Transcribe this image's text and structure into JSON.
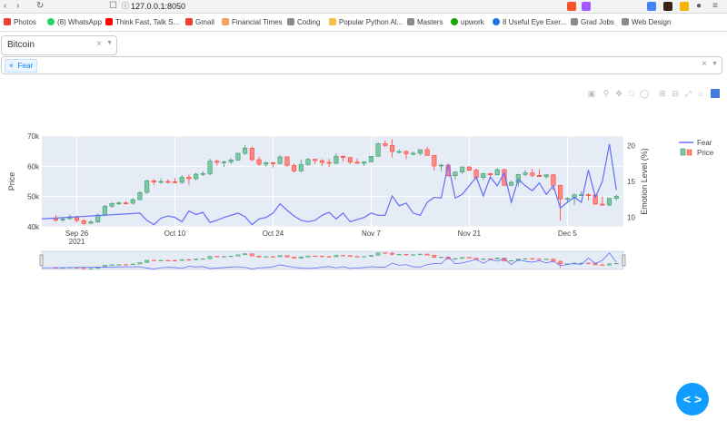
{
  "browser": {
    "url": "127.0.0.1:8050"
  },
  "bookmarks": [
    {
      "label": "Photos",
      "color": "#ea4335"
    },
    {
      "label": "(8) WhatsApp",
      "color": "#25d366"
    },
    {
      "label": "Think Fast, Talk S...",
      "color": "#ff0000"
    },
    {
      "label": "Gmail",
      "color": "#ea4335"
    },
    {
      "label": "Financial Times",
      "color": "#f4a261"
    },
    {
      "label": "Coding",
      "color": "#8a8a8a"
    },
    {
      "label": "Popular Python Al...",
      "color": "#f6c343"
    },
    {
      "label": "Masters",
      "color": "#8a8a8a"
    },
    {
      "label": "upwork",
      "color": "#14a800"
    },
    {
      "label": "8 Useful Eye Exer...",
      "color": "#1a73e8"
    },
    {
      "label": "Grad Jobs",
      "color": "#8a8a8a"
    },
    {
      "label": "Web Design",
      "color": "#8a8a8a"
    }
  ],
  "controls": {
    "coin_dropdown_value": "Bitcoin",
    "indicator_tags": [
      "Fear"
    ]
  },
  "chart_data": {
    "type": "candlestick+line",
    "y_left_label": "Price",
    "y_right_label": "Emotion Level (%)",
    "y_left_ticks": [
      "40k",
      "50k",
      "60k",
      "70k"
    ],
    "y_left_range": [
      40000,
      70000
    ],
    "y_right_ticks": [
      "10",
      "15",
      "20"
    ],
    "y_right_range": [
      8.7,
      21.3
    ],
    "x_ticks": [
      {
        "date": "2021-09-26",
        "label": "Sep 26",
        "sub": "2021"
      },
      {
        "date": "2021-10-10",
        "label": "Oct 10",
        "sub": ""
      },
      {
        "date": "2021-10-24",
        "label": "Oct 24",
        "sub": ""
      },
      {
        "date": "2021-11-07",
        "label": "Nov 7",
        "sub": ""
      },
      {
        "date": "2021-11-21",
        "label": "Nov 21",
        "sub": ""
      },
      {
        "date": "2021-12-05",
        "label": "Dec 5",
        "sub": ""
      }
    ],
    "x_range": [
      "2021-09-21",
      "2021-12-13"
    ],
    "colors": {
      "increasing": "#3d9970",
      "increasing_fill": "#7cc8a2",
      "decreasing": "#ff4136",
      "decreasing_fill": "#ff8a84",
      "fear": "#636efa",
      "plot_bg": "#e5ecf6"
    },
    "legend": [
      {
        "name": "Fear",
        "kind": "line"
      },
      {
        "name": "Price",
        "kind": "candle"
      }
    ],
    "candles": [
      {
        "date": "2021-09-23",
        "open": 42900,
        "close": 42200,
        "high": 43900,
        "low": 41600
      },
      {
        "date": "2021-09-24",
        "open": 42200,
        "close": 42500,
        "high": 43100,
        "low": 41700
      },
      {
        "date": "2021-09-25",
        "open": 42700,
        "close": 43300,
        "high": 44000,
        "low": 42300
      },
      {
        "date": "2021-09-26",
        "open": 43300,
        "close": 42100,
        "high": 43700,
        "low": 41400
      },
      {
        "date": "2021-09-27",
        "open": 42000,
        "close": 41100,
        "high": 42600,
        "low": 40700
      },
      {
        "date": "2021-09-28",
        "open": 41200,
        "close": 41600,
        "high": 42300,
        "low": 40900
      },
      {
        "date": "2021-09-29",
        "open": 41600,
        "close": 43900,
        "high": 44300,
        "low": 41300
      },
      {
        "date": "2021-09-30",
        "open": 43900,
        "close": 46800,
        "high": 47200,
        "low": 43500
      },
      {
        "date": "2021-10-01",
        "open": 46800,
        "close": 47700,
        "high": 48100,
        "low": 46300
      },
      {
        "date": "2021-10-02",
        "open": 47700,
        "close": 47900,
        "high": 48400,
        "low": 47200
      },
      {
        "date": "2021-10-03",
        "open": 47900,
        "close": 47800,
        "high": 48500,
        "low": 47400
      },
      {
        "date": "2021-10-04",
        "open": 47800,
        "close": 49000,
        "high": 49500,
        "low": 47300
      },
      {
        "date": "2021-10-05",
        "open": 49000,
        "close": 51300,
        "high": 51700,
        "low": 48700
      },
      {
        "date": "2021-10-06",
        "open": 51400,
        "close": 55200,
        "high": 55600,
        "low": 50900
      },
      {
        "date": "2021-10-07",
        "open": 55200,
        "close": 54800,
        "high": 55800,
        "low": 53800
      },
      {
        "date": "2021-10-08",
        "open": 54800,
        "close": 55000,
        "high": 56000,
        "low": 54200
      },
      {
        "date": "2021-10-09",
        "open": 55000,
        "close": 54900,
        "high": 55600,
        "low": 54300
      },
      {
        "date": "2021-10-10",
        "open": 54900,
        "close": 54700,
        "high": 56100,
        "low": 54400
      },
      {
        "date": "2021-10-11",
        "open": 54700,
        "close": 56400,
        "high": 57100,
        "low": 54200
      },
      {
        "date": "2021-10-12",
        "open": 56400,
        "close": 55900,
        "high": 57300,
        "low": 54000
      },
      {
        "date": "2021-10-13",
        "open": 55900,
        "close": 57400,
        "high": 57800,
        "low": 55300
      },
      {
        "date": "2021-10-14",
        "open": 57400,
        "close": 57600,
        "high": 58300,
        "low": 56800
      },
      {
        "date": "2021-10-15",
        "open": 57600,
        "close": 61700,
        "high": 62500,
        "low": 57000
      },
      {
        "date": "2021-10-16",
        "open": 61700,
        "close": 61300,
        "high": 62300,
        "low": 60200
      },
      {
        "date": "2021-10-17",
        "open": 61300,
        "close": 61500,
        "high": 61900,
        "low": 59800
      },
      {
        "date": "2021-10-18",
        "open": 61500,
        "close": 62100,
        "high": 62700,
        "low": 60800
      },
      {
        "date": "2021-10-19",
        "open": 62100,
        "close": 64300,
        "high": 64500,
        "low": 61700
      },
      {
        "date": "2021-10-20",
        "open": 64300,
        "close": 66000,
        "high": 67000,
        "low": 63700
      },
      {
        "date": "2021-10-21",
        "open": 66000,
        "close": 62200,
        "high": 66600,
        "low": 61600
      },
      {
        "date": "2021-10-22",
        "open": 62200,
        "close": 60700,
        "high": 63200,
        "low": 60100
      },
      {
        "date": "2021-10-23",
        "open": 60700,
        "close": 61200,
        "high": 61700,
        "low": 59900
      },
      {
        "date": "2021-10-24",
        "open": 61200,
        "close": 60900,
        "high": 61500,
        "low": 59600
      },
      {
        "date": "2021-10-25",
        "open": 60900,
        "close": 63100,
        "high": 63700,
        "low": 60600
      },
      {
        "date": "2021-10-26",
        "open": 63100,
        "close": 60300,
        "high": 63300,
        "low": 59900
      },
      {
        "date": "2021-10-27",
        "open": 60300,
        "close": 58500,
        "high": 61000,
        "low": 58000
      },
      {
        "date": "2021-10-28",
        "open": 58500,
        "close": 60600,
        "high": 62200,
        "low": 58100
      },
      {
        "date": "2021-10-29",
        "open": 60600,
        "close": 62300,
        "high": 62800,
        "low": 60200
      },
      {
        "date": "2021-10-30",
        "open": 62300,
        "close": 61900,
        "high": 62500,
        "low": 60700
      },
      {
        "date": "2021-10-31",
        "open": 61900,
        "close": 61300,
        "high": 62400,
        "low": 60100
      },
      {
        "date": "2021-11-01",
        "open": 61300,
        "close": 61000,
        "high": 62400,
        "low": 59700
      },
      {
        "date": "2021-11-02",
        "open": 61000,
        "close": 63300,
        "high": 64300,
        "low": 60700
      },
      {
        "date": "2021-11-03",
        "open": 63300,
        "close": 62900,
        "high": 63600,
        "low": 61600
      },
      {
        "date": "2021-11-04",
        "open": 62900,
        "close": 61400,
        "high": 63100,
        "low": 60700
      },
      {
        "date": "2021-11-05",
        "open": 61400,
        "close": 61000,
        "high": 62600,
        "low": 60800
      },
      {
        "date": "2021-11-06",
        "open": 61000,
        "close": 61500,
        "high": 61600,
        "low": 60100
      },
      {
        "date": "2021-11-07",
        "open": 61500,
        "close": 63300,
        "high": 63300,
        "low": 61300
      },
      {
        "date": "2021-11-08",
        "open": 63300,
        "close": 67500,
        "high": 67800,
        "low": 63300
      },
      {
        "date": "2021-11-09",
        "open": 67500,
        "close": 66900,
        "high": 68500,
        "low": 66300
      },
      {
        "date": "2021-11-10",
        "open": 66900,
        "close": 64900,
        "high": 69000,
        "low": 62900
      },
      {
        "date": "2021-11-11",
        "open": 64900,
        "close": 64900,
        "high": 65600,
        "low": 64200
      },
      {
        "date": "2021-11-12",
        "open": 64900,
        "close": 64200,
        "high": 65300,
        "low": 62300
      },
      {
        "date": "2021-11-13",
        "open": 64200,
        "close": 64300,
        "high": 64900,
        "low": 63600
      },
      {
        "date": "2021-11-14",
        "open": 64300,
        "close": 65500,
        "high": 65500,
        "low": 63600
      },
      {
        "date": "2021-11-15",
        "open": 65500,
        "close": 63600,
        "high": 66400,
        "low": 63500
      },
      {
        "date": "2021-11-16",
        "open": 63600,
        "close": 60100,
        "high": 63600,
        "low": 58600
      },
      {
        "date": "2021-11-17",
        "open": 60100,
        "close": 60400,
        "high": 60800,
        "low": 58400
      },
      {
        "date": "2021-11-18",
        "open": 60400,
        "close": 56900,
        "high": 60900,
        "low": 56500
      },
      {
        "date": "2021-11-19",
        "open": 56900,
        "close": 58100,
        "high": 58300,
        "low": 55700
      },
      {
        "date": "2021-11-20",
        "open": 58100,
        "close": 59800,
        "high": 59900,
        "low": 57500
      },
      {
        "date": "2021-11-21",
        "open": 59800,
        "close": 58700,
        "high": 60000,
        "low": 58500
      },
      {
        "date": "2021-11-22",
        "open": 58700,
        "close": 56300,
        "high": 59200,
        "low": 55700
      },
      {
        "date": "2021-11-23",
        "open": 56300,
        "close": 57600,
        "high": 57800,
        "low": 55500
      },
      {
        "date": "2021-11-24",
        "open": 57600,
        "close": 57200,
        "high": 57800,
        "low": 55900
      },
      {
        "date": "2021-11-25",
        "open": 57200,
        "close": 58900,
        "high": 59400,
        "low": 57000
      },
      {
        "date": "2021-11-26",
        "open": 58900,
        "close": 53700,
        "high": 59200,
        "low": 53600
      },
      {
        "date": "2021-11-27",
        "open": 53700,
        "close": 54700,
        "high": 55300,
        "low": 53600
      },
      {
        "date": "2021-11-28",
        "open": 54700,
        "close": 57300,
        "high": 57400,
        "low": 53300
      },
      {
        "date": "2021-11-29",
        "open": 57300,
        "close": 57800,
        "high": 58800,
        "low": 56700
      },
      {
        "date": "2021-11-30",
        "open": 57800,
        "close": 57000,
        "high": 59200,
        "low": 56400
      },
      {
        "date": "2021-12-01",
        "open": 57000,
        "close": 56600,
        "high": 59000,
        "low": 56500
      },
      {
        "date": "2021-12-02",
        "open": 56600,
        "close": 57200,
        "high": 57300,
        "low": 55900
      },
      {
        "date": "2021-12-03",
        "open": 57200,
        "close": 53700,
        "high": 57500,
        "low": 52000
      },
      {
        "date": "2021-12-04",
        "open": 53700,
        "close": 49200,
        "high": 53900,
        "low": 42000
      },
      {
        "date": "2021-12-05",
        "open": 49200,
        "close": 49400,
        "high": 49700,
        "low": 47800
      },
      {
        "date": "2021-12-06",
        "open": 49400,
        "close": 50600,
        "high": 51000,
        "low": 47300
      },
      {
        "date": "2021-12-07",
        "open": 50600,
        "close": 50600,
        "high": 51800,
        "low": 50200
      },
      {
        "date": "2021-12-08",
        "open": 50600,
        "close": 50500,
        "high": 51100,
        "low": 48700
      },
      {
        "date": "2021-12-09",
        "open": 50500,
        "close": 47500,
        "high": 50800,
        "low": 47300
      },
      {
        "date": "2021-12-10",
        "open": 47500,
        "close": 47200,
        "high": 50000,
        "low": 46900
      },
      {
        "date": "2021-12-11",
        "open": 47200,
        "close": 49400,
        "high": 49500,
        "low": 46800
      },
      {
        "date": "2021-12-12",
        "open": 49400,
        "close": 50100,
        "high": 50700,
        "low": 48700
      }
    ],
    "fear": [
      {
        "date": "2021-09-21",
        "value": 9.8
      },
      {
        "date": "2021-10-05",
        "value": 10.6
      },
      {
        "date": "2021-10-06",
        "value": 9.6
      },
      {
        "date": "2021-10-07",
        "value": 9.0
      },
      {
        "date": "2021-10-08",
        "value": 9.9
      },
      {
        "date": "2021-10-09",
        "value": 10.2
      },
      {
        "date": "2021-10-10",
        "value": 10.0
      },
      {
        "date": "2021-10-11",
        "value": 9.4
      },
      {
        "date": "2021-10-12",
        "value": 10.9
      },
      {
        "date": "2021-10-13",
        "value": 10.4
      },
      {
        "date": "2021-10-14",
        "value": 10.7
      },
      {
        "date": "2021-10-15",
        "value": 9.3
      },
      {
        "date": "2021-10-16",
        "value": 9.6
      },
      {
        "date": "2021-10-17",
        "value": 10.0
      },
      {
        "date": "2021-10-18",
        "value": 10.3
      },
      {
        "date": "2021-10-19",
        "value": 10.6
      },
      {
        "date": "2021-10-20",
        "value": 10.1
      },
      {
        "date": "2021-10-21",
        "value": 9.0
      },
      {
        "date": "2021-10-22",
        "value": 9.8
      },
      {
        "date": "2021-10-23",
        "value": 10.0
      },
      {
        "date": "2021-10-24",
        "value": 10.6
      },
      {
        "date": "2021-10-25",
        "value": 11.9
      },
      {
        "date": "2021-10-26",
        "value": 11.0
      },
      {
        "date": "2021-10-27",
        "value": 10.2
      },
      {
        "date": "2021-10-28",
        "value": 9.6
      },
      {
        "date": "2021-10-29",
        "value": 9.4
      },
      {
        "date": "2021-10-30",
        "value": 9.6
      },
      {
        "date": "2021-10-31",
        "value": 10.3
      },
      {
        "date": "2021-11-01",
        "value": 10.7
      },
      {
        "date": "2021-11-02",
        "value": 9.8
      },
      {
        "date": "2021-11-03",
        "value": 10.6
      },
      {
        "date": "2021-11-04",
        "value": 9.4
      },
      {
        "date": "2021-11-05",
        "value": 9.7
      },
      {
        "date": "2021-11-06",
        "value": 10.0
      },
      {
        "date": "2021-11-07",
        "value": 10.6
      },
      {
        "date": "2021-11-08",
        "value": 10.3
      },
      {
        "date": "2021-11-09",
        "value": 10.3
      },
      {
        "date": "2021-11-10",
        "value": 13.0
      },
      {
        "date": "2021-11-11",
        "value": 11.6
      },
      {
        "date": "2021-11-12",
        "value": 12.0
      },
      {
        "date": "2021-11-13",
        "value": 10.6
      },
      {
        "date": "2021-11-14",
        "value": 10.3
      },
      {
        "date": "2021-11-15",
        "value": 12.1
      },
      {
        "date": "2021-11-16",
        "value": 12.8
      },
      {
        "date": "2021-11-17",
        "value": 12.7
      },
      {
        "date": "2021-11-18",
        "value": 17.4
      },
      {
        "date": "2021-11-19",
        "value": 12.7
      },
      {
        "date": "2021-11-20",
        "value": 13.2
      },
      {
        "date": "2021-11-21",
        "value": 14.4
      },
      {
        "date": "2021-11-22",
        "value": 15.6
      },
      {
        "date": "2021-11-23",
        "value": 13.0
      },
      {
        "date": "2021-11-24",
        "value": 15.6
      },
      {
        "date": "2021-11-25",
        "value": 14.4
      },
      {
        "date": "2021-11-26",
        "value": 16.2
      },
      {
        "date": "2021-11-27",
        "value": 12.1
      },
      {
        "date": "2021-11-28",
        "value": 15.3
      },
      {
        "date": "2021-11-29",
        "value": 14.4
      },
      {
        "date": "2021-11-30",
        "value": 13.7
      },
      {
        "date": "2021-12-01",
        "value": 14.8
      },
      {
        "date": "2021-12-02",
        "value": 13.2
      },
      {
        "date": "2021-12-03",
        "value": 14.4
      },
      {
        "date": "2021-12-04",
        "value": 11.3
      },
      {
        "date": "2021-12-05",
        "value": 12.1
      },
      {
        "date": "2021-12-06",
        "value": 12.8
      },
      {
        "date": "2021-12-07",
        "value": 12.1
      },
      {
        "date": "2021-12-08",
        "value": 16.6
      },
      {
        "date": "2021-12-09",
        "value": 12.8
      },
      {
        "date": "2021-12-10",
        "value": 15.0
      },
      {
        "date": "2021-12-11",
        "value": 20.2
      },
      {
        "date": "2021-12-12",
        "value": 13.8
      }
    ]
  }
}
